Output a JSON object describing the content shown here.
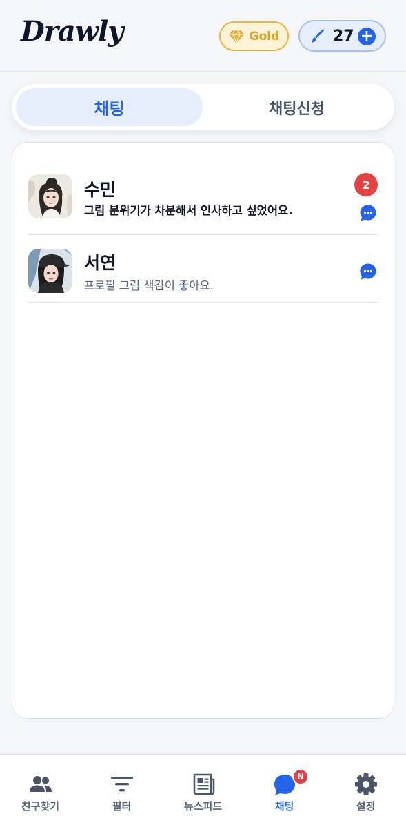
{
  "app": {
    "logo": "Drawly"
  },
  "header": {
    "membership_label": "Gold",
    "brush_count": "27",
    "add_label": "+"
  },
  "tabs": [
    {
      "label": "채팅",
      "active": true
    },
    {
      "label": "채팅신청",
      "active": false
    }
  ],
  "chats": [
    {
      "name": "수민",
      "preview": "그림 분위기가 차분해서 인사하고 싶었어요.",
      "unread": "2",
      "avatar": "portrait-bun-hair"
    },
    {
      "name": "서연",
      "preview": "프로필 그림 색감이 좋아요.",
      "unread": null,
      "avatar": "portrait-cap"
    }
  ],
  "nav": {
    "items": [
      {
        "label": "친구찾기",
        "icon": "people-icon"
      },
      {
        "label": "필터",
        "icon": "filter-icon"
      },
      {
        "label": "뉴스피드",
        "icon": "newspaper-icon"
      },
      {
        "label": "채팅",
        "icon": "chat-icon",
        "active": true,
        "badge": "N"
      },
      {
        "label": "설정",
        "icon": "gear-icon"
      }
    ]
  },
  "colors": {
    "accent": "#2563eb",
    "badge_red": "#e34242",
    "gold": "#f0b43c",
    "background": "#f4f6fa"
  }
}
